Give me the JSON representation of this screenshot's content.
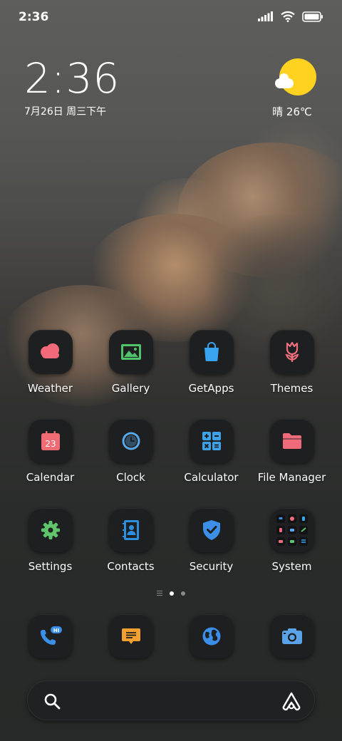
{
  "status_bar": {
    "time": "2:36",
    "icons": [
      "signal-icon",
      "wifi-icon",
      "battery-icon"
    ]
  },
  "clock_widget": {
    "time": "2:36",
    "date": "7月26日 周三下午"
  },
  "weather_widget": {
    "icon": "sun-cloud-icon",
    "text": "晴 26℃"
  },
  "apps": [
    {
      "label": "Weather",
      "icon": "weather-cloud-icon"
    },
    {
      "label": "Gallery",
      "icon": "gallery-image-icon"
    },
    {
      "label": "GetApps",
      "icon": "shopping-bag-icon"
    },
    {
      "label": "Themes",
      "icon": "tulip-icon"
    },
    {
      "label": "Calendar",
      "icon": "calendar-icon",
      "badge": "23"
    },
    {
      "label": "Clock",
      "icon": "clock-icon"
    },
    {
      "label": "Calculator",
      "icon": "calculator-icon"
    },
    {
      "label": "File Manager",
      "icon": "folder-icon"
    },
    {
      "label": "Settings",
      "icon": "gear-icon"
    },
    {
      "label": "Contacts",
      "icon": "contacts-book-icon"
    },
    {
      "label": "Security",
      "icon": "shield-check-icon"
    },
    {
      "label": "System",
      "icon": "folder-grid-icon"
    }
  ],
  "page_indicator": {
    "pages": 2,
    "current": 1
  },
  "dock": [
    {
      "name": "phone",
      "icon": "phone-icon",
      "badge": "HI"
    },
    {
      "name": "messages",
      "icon": "message-icon"
    },
    {
      "name": "browser",
      "icon": "globe-icon"
    },
    {
      "name": "camera",
      "icon": "camera-icon"
    }
  ],
  "search": {
    "icon": "search-icon",
    "assistant_icon": "assistant-icon"
  },
  "colors": {
    "sun": "#ffd21f",
    "weather": "#f26a7a",
    "gallery": "#4fc46b",
    "getapps": "#38a3f0",
    "themes": "#ef6f7d",
    "calendar": "#f06b73",
    "clock": "#58a8e8",
    "calculator": "#3fa1e6",
    "files": "#ef6b7c",
    "settings": "#5fc46a",
    "contacts": "#2d8fe0",
    "security": "#3b8fe8",
    "messages": "#f3a030",
    "camera": "#5aa3e8"
  }
}
